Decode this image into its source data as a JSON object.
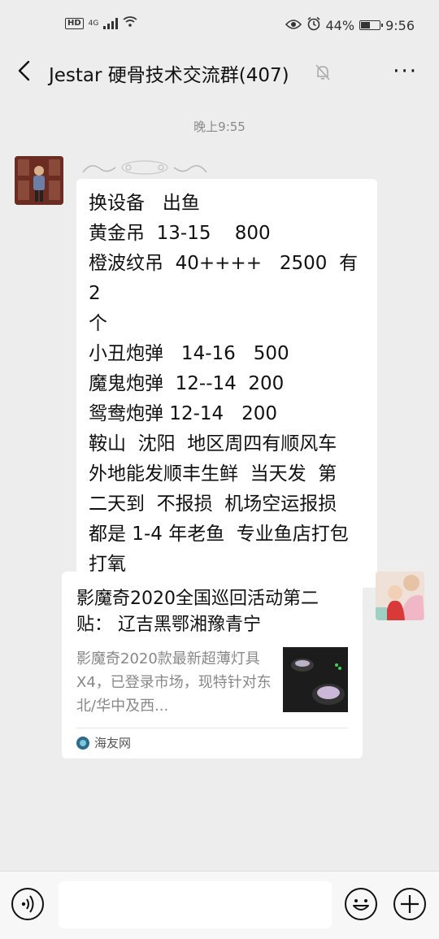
{
  "status_bar": {
    "hd": "HD",
    "network": "4G",
    "battery_percent": "44%",
    "battery_level": 0.44,
    "time": "9:56"
  },
  "header": {
    "title": "Jestar 硬骨技术交流群(407)",
    "back_icon": "chevron-left-icon",
    "mute_icon": "bell-off-icon",
    "more_icon": "more-icon",
    "more_label": "···"
  },
  "chat": {
    "timestamp": "晚上9:55",
    "messages": [
      {
        "side": "left",
        "text": "换设备   出鱼\n黄金吊  13-15    800\n橙波纹吊  40++++   2500  有 2\n个\n小丑炮弹   14-16   500\n魔鬼炮弹  12--14  200\n鸳鸯炮弹 12-14   200\n鞍山  沈阳  地区周四有顺风车\n外地能发顺丰生鲜  当天发  第\n二天到  不报损  机场空运报损\n都是 1-4 年老鱼  专业鱼店打包\n打氧"
      }
    ],
    "link_card": {
      "side": "right",
      "title": "影魔奇2020全国巡回活动第二贴： 辽吉黑鄂湘豫青宁",
      "description": "影魔奇2020款最新超薄灯具X4，已登录市场，现特针对东北/华中及西...",
      "source": "海友网"
    }
  },
  "input_bar": {
    "placeholder": "",
    "voice_icon": "voice-icon",
    "emoji_icon": "emoji-icon",
    "plus_icon": "plus-icon"
  },
  "colors": {
    "background": "#ededed",
    "bubble": "#ffffff",
    "timestamp": "#8a8a8a",
    "source_text": "#555555"
  }
}
